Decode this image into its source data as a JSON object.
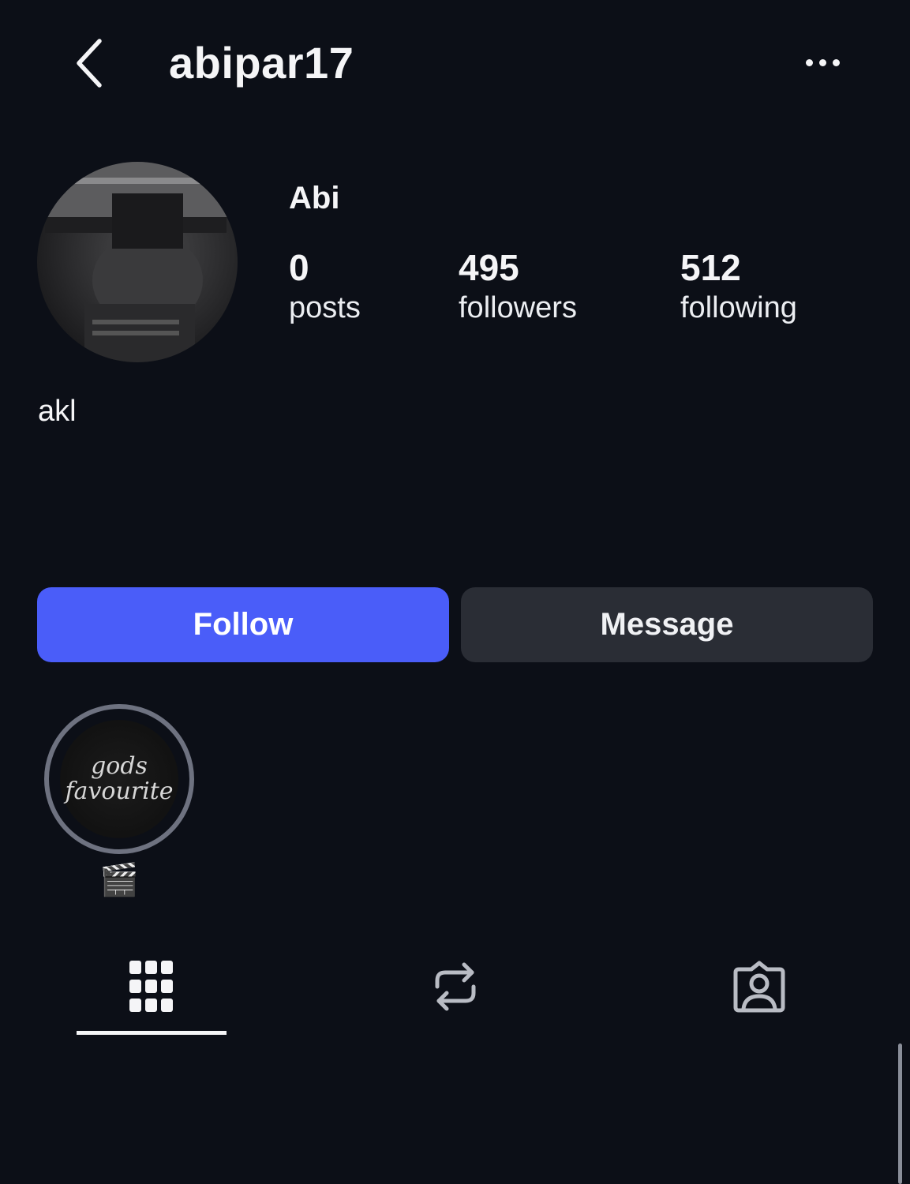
{
  "header": {
    "username": "abipar17",
    "back_icon": "chevron-left-icon",
    "more_icon": "ellipsis-icon"
  },
  "profile": {
    "display_name": "Abi",
    "bio": "akl",
    "stats": [
      {
        "count": "0",
        "label": "posts"
      },
      {
        "count": "495",
        "label": "followers"
      },
      {
        "count": "512",
        "label": "following"
      }
    ]
  },
  "actions": {
    "follow_label": "Follow",
    "message_label": "Message",
    "follow_color": "#4a5df9",
    "message_color": "#2a2d35"
  },
  "highlights": [
    {
      "cover_text_1": "gods",
      "cover_text_2": "favourite",
      "label": "🎬"
    }
  ],
  "tabs": [
    {
      "icon": "grid-icon",
      "active": true
    },
    {
      "icon": "repost-icon",
      "active": false
    },
    {
      "icon": "tagged-person-icon",
      "active": false
    }
  ],
  "theme": {
    "background": "#0c0f17",
    "text": "#f5f5f7"
  }
}
